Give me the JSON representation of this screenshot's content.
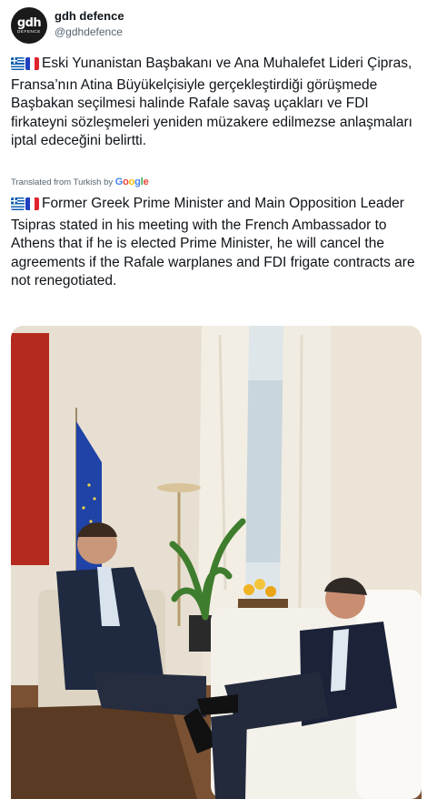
{
  "account": {
    "display_name": "gdh defence",
    "handle": "@gdhdefence",
    "avatar": {
      "logo_text": "gdh",
      "sub_text": "DEFENCE"
    }
  },
  "tweet": {
    "flags": [
      "greece-flag",
      "france-flag"
    ],
    "text_original": "Eski Yunanistan Başbakanı ve Ana Muhalefet Lideri Çipras, Fransa’nın Atina Büyükelçisiyle gerçekleştirdiği görüşmede Başbakan seçilmesi halinde Rafale savaş uçakları ve FDI firkateyni sözleşmeleri yeniden müzakere edilmezse anlaşmaları iptal edeceğini belirtti.",
    "translation_label": "Translated from Turkish by",
    "translation_provider": "Google",
    "text_translated": "Former Greek Prime Minister and Main Opposition Leader Tsipras stated in his meeting with the French Ambassador to Athens that if he is elected Prime Minister, he will cancel the agreements if the Rafale warplanes and FDI frigate contracts are not renegotiated."
  },
  "colors": {
    "text": "#0f1419",
    "muted": "#536471",
    "google_blue": "#4285f4",
    "google_red": "#ea4335",
    "google_yellow": "#fbbc05",
    "google_green": "#34a853"
  }
}
